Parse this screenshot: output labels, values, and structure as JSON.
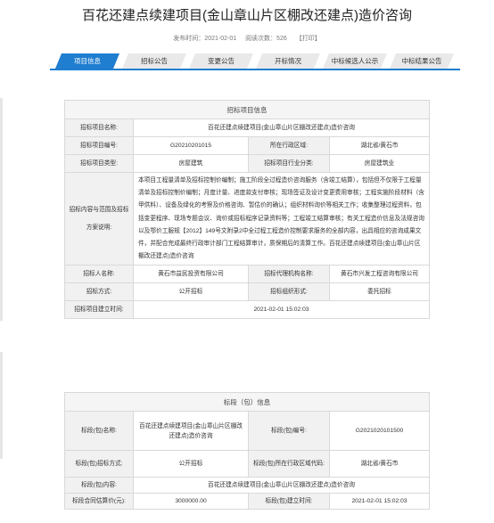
{
  "title": "百花还建点续建项目(金山章山片区棚改还建点)造价咨询",
  "meta": {
    "publish_time": "发布时间：2021-02-01",
    "views": "阅读次数：526",
    "print": "【打印】"
  },
  "tabs": [
    "项目信息",
    "招标公告",
    "变更公告",
    "开标情况",
    "中标候选人公示",
    "中标结果公告"
  ],
  "project_info": {
    "header": "招标项目信息",
    "name_label": "招标项目名称:",
    "name_value": "百花还建点续建项目(金山章山片区棚改还建点)造价咨询",
    "code_label": "招标项目编号:",
    "code_value": "G20210201015",
    "region_label": "所在行政区域:",
    "region_value": "湖北省/黄石市",
    "type_label": "招标项目类型:",
    "type_value": "房屋建筑",
    "industry_label": "招标项目行业分类:",
    "industry_value": "房屋建筑业",
    "scope_label": "招标内容与范围及招标方案说明:",
    "scope_value": "本项目工程量清单及招标控制价编制；施工阶段全过程造价咨询服务（含竣工结算），包括但不仅限于工程量清单及招标控制价编制；月度计量、进度款支付审核；现场签证及设计变更费用审核；工程实施阶段材料（含甲供料）、设备及绿化的考察及价格咨询、暂估价的确认；组织材料询价等相关工作；收集整理过程资料，包括变更程序、现场专题会议、询价或招标程序记录资料等；工程竣工结算审核；有关工程造价信息及法规咨询以及鄂价工服规【2012】149号文附录2中全过程工程造价控制要求服务的全部内容，出具相应的咨询成果文件，并配合完成最终行政审计部门工程结算审计，质保期后的清算工作。百花还建点续建项目(金山章山片区棚改还建点)造价咨询",
    "tenderer_label": "招标人名称:",
    "tenderer_value": "黄石市益民投资有限公司",
    "agency_label": "招标代理机构名称:",
    "agency_value": "黄石市兴发工程咨询有限公司",
    "method_label": "招标方式:",
    "method_value": "公开招标",
    "org_form_label": "招标组织形式:",
    "org_form_value": "委托招标",
    "setup_time_label": "招标项目建立时间:",
    "setup_time_value": "2021-02-01 15:02:03"
  },
  "section_info": {
    "header": "标段（包）信息",
    "name_label": "标段(包)名称:",
    "name_value": "百花还建点续建项目(金山章山片区棚改还建点)造价咨询",
    "code_label": "标段(包)编号:",
    "code_value": "G2021020101500",
    "method_label": "标段(包)招标方式:",
    "method_value": "公开招标",
    "region_label": "标段(包)所在行政区域代码:",
    "region_value": "湖北省/黄石市",
    "content_label": "标段(包)内容:",
    "content_value": "百花还建点续建项目(金山章山片区棚改还建点)造价咨询",
    "price_label": "标段合同估算价(元):",
    "price_value": "3000000.00",
    "setup_time_label": "标段(包)建立时间:",
    "setup_time_value": "2021-02-01 15:02:03"
  }
}
